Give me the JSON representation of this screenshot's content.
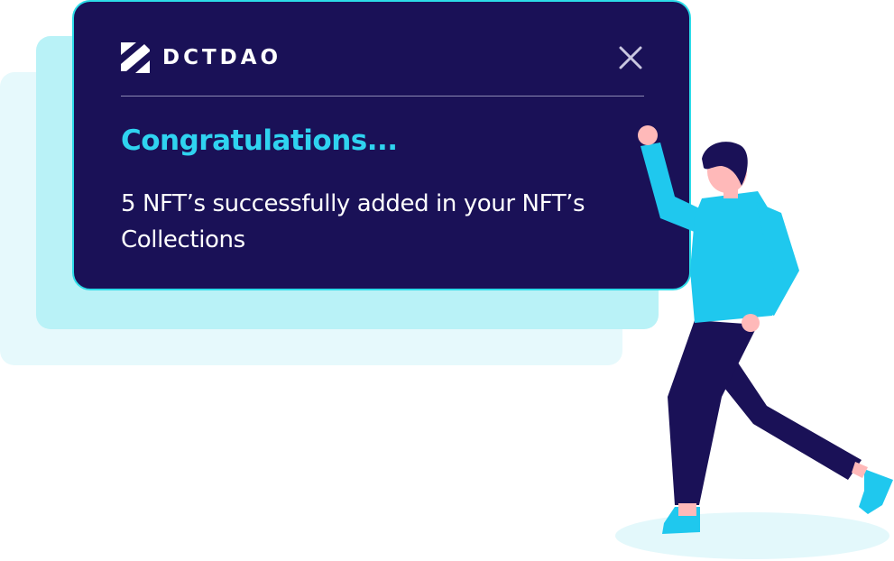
{
  "notification": {
    "brand_name": "DCTDAO",
    "title": "Congratulations...",
    "message": "5 NFT’s successfully added in your NFT’s Collections",
    "close_icon": "close-icon"
  },
  "colors": {
    "modal_background": "#1a1157",
    "modal_border": "#2cdce8",
    "title": "#2fd3f0",
    "text": "#ffffff",
    "ghost_light": "#e6f9fc",
    "ghost_mid": "#b9f2f7",
    "figure_shirt": "#1fc8ee",
    "figure_pants": "#1a1157",
    "figure_skin": "#ffb9b9",
    "figure_shoes": "#1fc8ee"
  }
}
